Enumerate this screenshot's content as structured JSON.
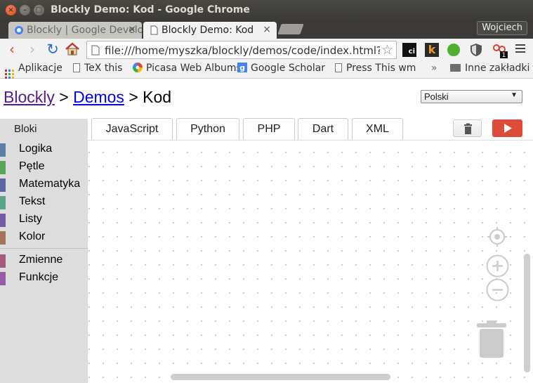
{
  "window": {
    "title": "Blockly Demo: Kod - Google Chrome",
    "controls": {
      "close": "×",
      "minimize": "–",
      "maximize": "□"
    }
  },
  "tabs": [
    {
      "label": "Blockly | Google Developers",
      "active": false
    },
    {
      "label": "Blockly Demo: Kod",
      "active": true
    }
  ],
  "tab_close": "×",
  "user": "Wojciech",
  "toolbar": {
    "back": "‹",
    "forward": "›",
    "reload": "↻",
    "url": "file:///home/myszka/blockly/demos/code/index.html?lang=pl",
    "star": "☆",
    "ext_ci": "ci",
    "ext_k": "k",
    "ext_badge": "1"
  },
  "bookmarks": {
    "apps": "Aplikacje",
    "tex": "TeX this",
    "picasa": "Picasa Web Albums",
    "scholar": "Google Scholar",
    "press": "Press This wm",
    "more": "»",
    "other": "Inne zakładki"
  },
  "page": {
    "breadcrumb_blockly": "Blockly",
    "breadcrumb_sep1": " > ",
    "breadcrumb_demos": "Demos",
    "breadcrumb_sep2": " > ",
    "breadcrumb_current": "Kod",
    "language": "Polski",
    "language_arrow": "▼"
  },
  "code_tabs": [
    "JavaScript",
    "Python",
    "PHP",
    "Dart",
    "XML"
  ],
  "toolbox": {
    "title": "Bloki",
    "categories": [
      {
        "label": "Logika",
        "color": "#5b80a5"
      },
      {
        "label": "Pętle",
        "color": "#5ba55b"
      },
      {
        "label": "Matematyka",
        "color": "#5b67a5"
      },
      {
        "label": "Tekst",
        "color": "#5ba58c"
      },
      {
        "label": "Listy",
        "color": "#745ba5"
      },
      {
        "label": "Kolor",
        "color": "#a5745b"
      },
      {
        "label": "Zmienne",
        "color": "#a55b80"
      },
      {
        "label": "Funkcje",
        "color": "#995ba5"
      }
    ]
  },
  "colors": {
    "run_button": "#dd4b39",
    "link_visited": "#551a8b",
    "link": "#0000ee"
  }
}
